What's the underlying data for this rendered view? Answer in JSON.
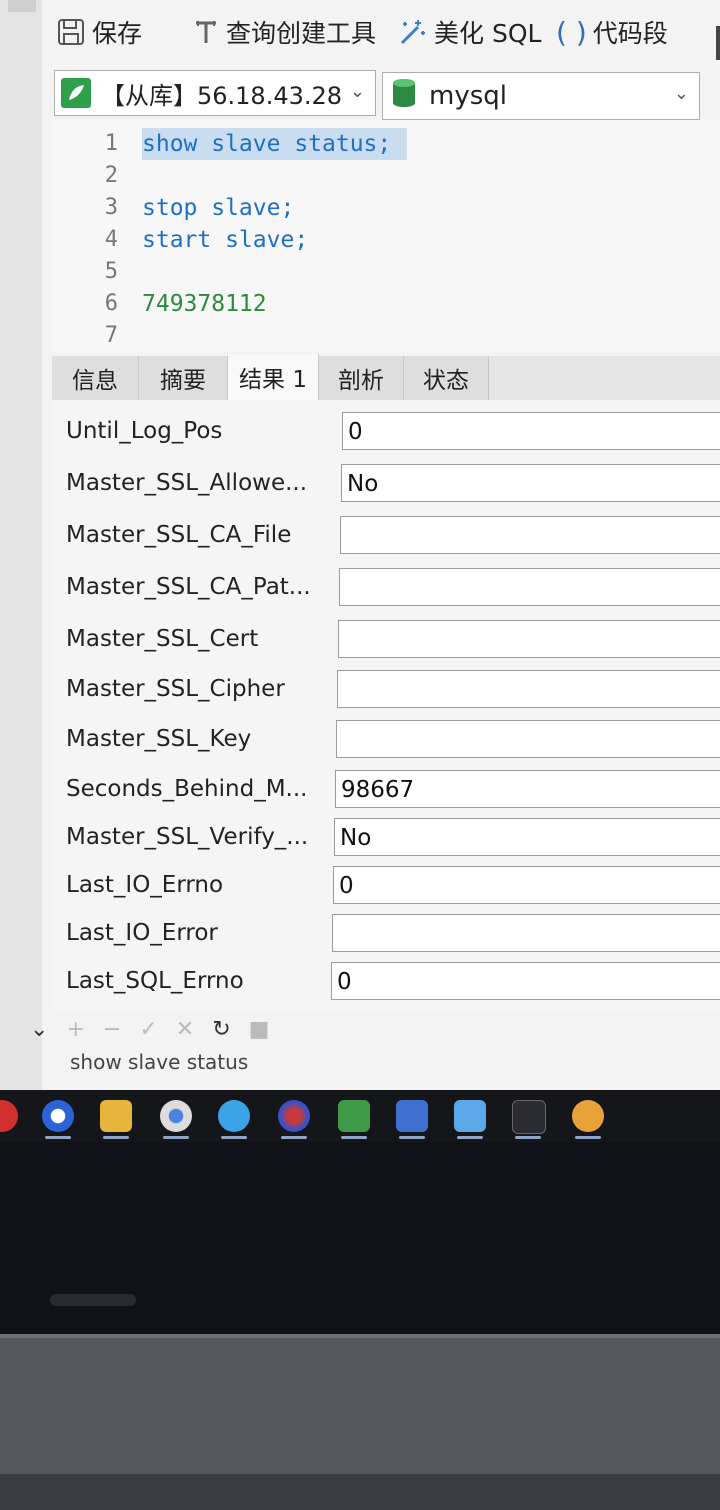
{
  "toolbar": {
    "save_label": "保存",
    "query_builder_label": "查询创建工具",
    "beautify_label": "美化 SQL",
    "snippet_label": "代码段"
  },
  "connection": {
    "name": "【从库】56.18.43.28",
    "database": "mysql"
  },
  "editor": {
    "lines": [
      {
        "num": "1",
        "code": "show slave status;"
      },
      {
        "num": "2",
        "code": ""
      },
      {
        "num": "3",
        "code": "stop slave;"
      },
      {
        "num": "4",
        "code": "start slave;"
      },
      {
        "num": "5",
        "code": ""
      },
      {
        "num": "6",
        "code": "749378112"
      },
      {
        "num": "7",
        "code": ""
      }
    ]
  },
  "tabs": [
    "信息",
    "摘要",
    "结果 1",
    "剖析",
    "状态"
  ],
  "active_tab": "结果 1",
  "fields": [
    {
      "label": "Until_Log_Pos",
      "value": "0"
    },
    {
      "label": "Master_SSL_Allowe...",
      "value": "No"
    },
    {
      "label": "Master_SSL_CA_File",
      "value": ""
    },
    {
      "label": "Master_SSL_CA_Pat...",
      "value": ""
    },
    {
      "label": "Master_SSL_Cert",
      "value": ""
    },
    {
      "label": "Master_SSL_Cipher",
      "value": ""
    },
    {
      "label": "Master_SSL_Key",
      "value": ""
    },
    {
      "label": "Seconds_Behind_M...",
      "value": "98667"
    },
    {
      "label": "Master_SSL_Verify_...",
      "value": "No"
    },
    {
      "label": "Last_IO_Errno",
      "value": "0"
    },
    {
      "label": "Last_IO_Error",
      "value": ""
    },
    {
      "label": "Last_SQL_Errno",
      "value": "0"
    }
  ],
  "bottom_toolbar": {
    "collapse_icon": "chevron-down-icon",
    "add_icon": "plus-icon",
    "remove_icon": "minus-icon",
    "apply_icon": "check-icon",
    "discard_icon": "x-icon",
    "refresh_icon": "refresh-icon",
    "stop_icon": "stop-icon"
  },
  "status_text": "show slave status",
  "colors": {
    "keyword": "#1f6fc2",
    "number": "#2b8a3e",
    "selection": "#c9dcf0"
  },
  "taskbar_icons": [
    "red-app-icon",
    "browser-icon",
    "file-explorer-icon",
    "chrome-icon",
    "app-icon",
    "globe-icon",
    "folder-app-icon",
    "network-icon",
    "desktop-icon",
    "terminal-icon",
    "navicat-icon"
  ]
}
